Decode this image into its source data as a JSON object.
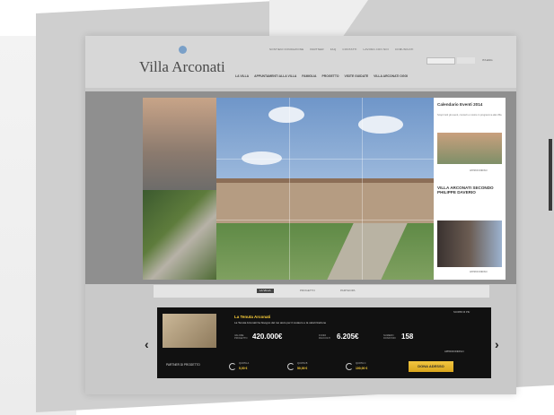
{
  "brand": {
    "name": "Villa Arconati"
  },
  "util_nav": [
    "SOSTIENI FONDAZIONE",
    "PARTNER",
    "FAQ",
    "CONTATTI",
    "LAVORA CON NOI",
    "COMUNICATI"
  ],
  "search": {
    "button": "CERCA",
    "lang": "ITA  ENG"
  },
  "main_nav": [
    "LA VILLA",
    "APPUNTAMENTI ALLA VILLA",
    "FAMIGLIA",
    "PROGETTO",
    "VISITE GUIDATE",
    "VILLA ARCONATI OGGI"
  ],
  "events": {
    "title1": "Calendario Eventi 2014",
    "text1": "Scopri tutti gli eventi, concerti e mostre in programma alla Villa",
    "more1": "APPROFONDISCI",
    "title2": "VILLA ARCONATI SECONDO PHILIPPE DAVERIO",
    "more2": "APPROFONDISCI"
  },
  "slider_tabs": [
    "LA VILLA",
    "PROGETTO",
    "PARTECIPA"
  ],
  "promo": {
    "title": "La Tenuta Arconati",
    "desc": "La Tenuta Arconati ha bisogno del tuo aiuto per il restauro e la valorizzazione",
    "link": "SCOPRI DI PIU",
    "link2": "APPROFONDISCI",
    "stats": [
      {
        "label": "VALORE PROGETTO",
        "value": "420.000€"
      },
      {
        "label": "FONDI RACCOLTI",
        "value": "6.205€"
      },
      {
        "label": "NUMERO DONATORI",
        "value": "158"
      }
    ],
    "partner_label": "PARTNER DI PROGETTO",
    "quotas": [
      {
        "name": "QUOTA A",
        "price": "5,00 €"
      },
      {
        "name": "QUOTA B",
        "price": "50,00 €"
      },
      {
        "name": "QUOTA C",
        "price": "100,00 €"
      }
    ],
    "donate": "DONA ADESSO"
  },
  "nav_arrows": {
    "prev": "‹",
    "next": "›"
  }
}
